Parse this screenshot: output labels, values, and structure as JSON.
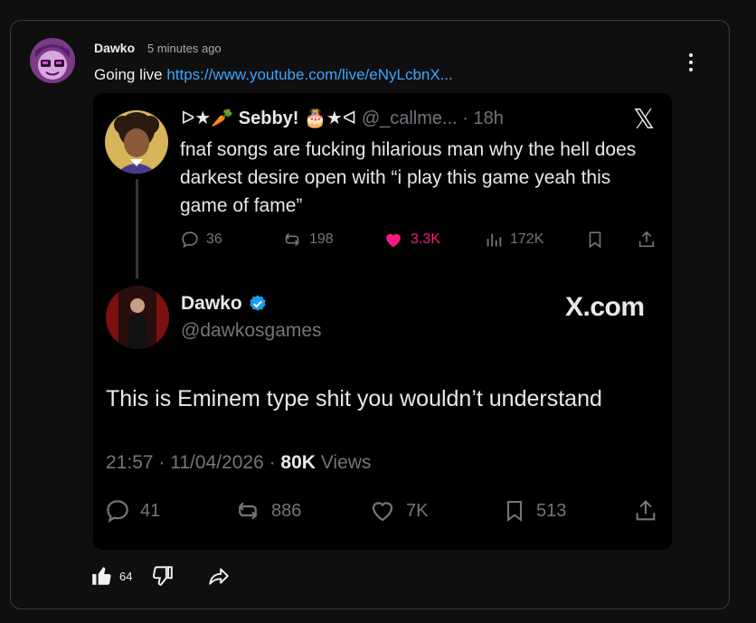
{
  "post": {
    "author": "Dawko",
    "time": "5 minutes ago",
    "text": "Going live ",
    "link": "https://www.youtube.com/live/eNyLcbnX..."
  },
  "quoted": {
    "prefix": "ᐅ★🥕",
    "name": "Sebby!",
    "suffix": "🎂★ᐊ",
    "handle": "@_callme...",
    "time": "18h",
    "text": "fnaf songs are fucking hilarious man why the hell does darkest desire open with “i play this game yeah this game of fame”",
    "replies": "36",
    "reposts": "198",
    "likes": "3.3K",
    "views": "172K"
  },
  "main_tweet": {
    "name": "Dawko",
    "handle": "@dawkosgames",
    "site": "X.com",
    "text": "This is Eminem type shit you wouldn’t understand",
    "datetime": "21:57 · 11/04/2026 · ",
    "views_count": "80K",
    "views_label": " Views",
    "replies": "41",
    "reposts": "886",
    "likes": "7K",
    "bookmarks": "513"
  },
  "footer": {
    "like_count": "64"
  },
  "colors": {
    "link": "#3ea6ff",
    "like_active": "#f91880",
    "verified": "#1d9bf0",
    "muted": "#71767b"
  }
}
